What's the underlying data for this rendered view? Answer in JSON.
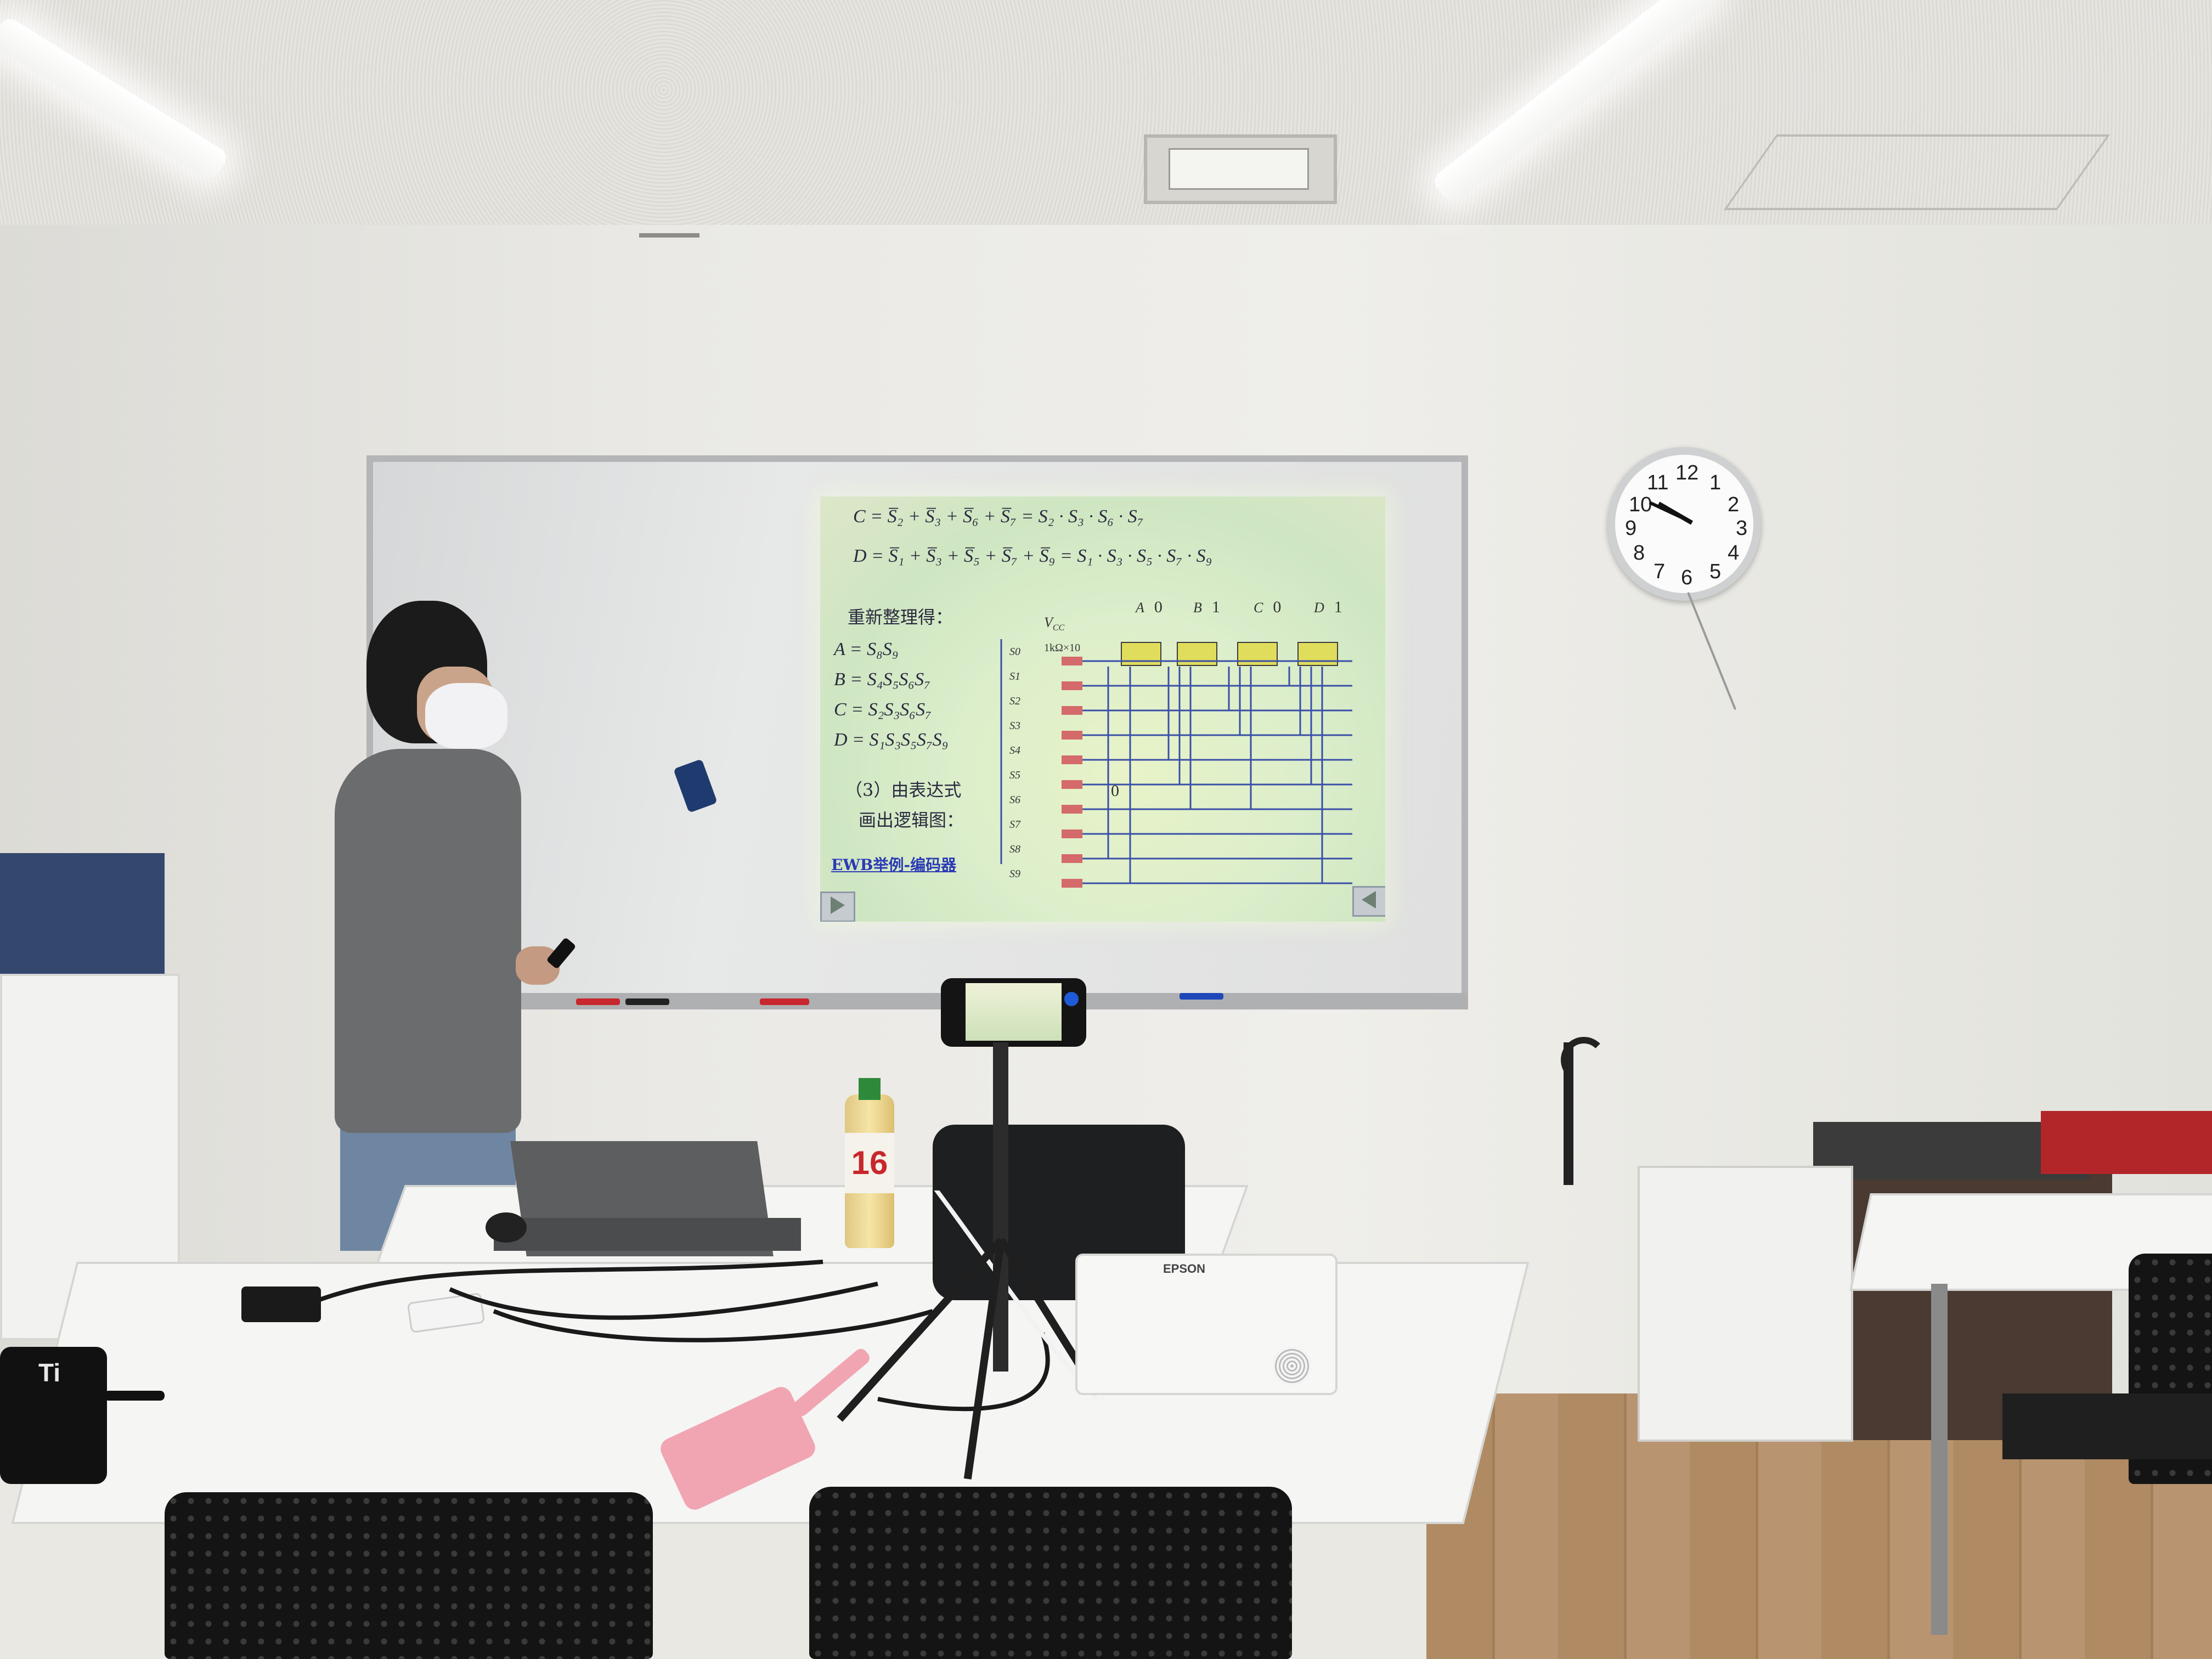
{
  "slide": {
    "eq_c": "C = S̅₂ + S̅₃ + S̅₆  + S̅₇ = S₂ · S₃ · S₆ · S₇",
    "eq_d": "D = S̅₁ + S̅₃ + S̅₅ + S̅₇ + S̅₉ = S₁ · S₃ · S₅ · S₇ · S₉",
    "heading": "重新整理得：",
    "expr_a": "A = S₈S₉",
    "expr_b": "B = S₄S₅S₆S₇",
    "expr_c": "C = S₂S₃S₆S₇",
    "expr_d": "D = S₁S₃S₅S₇S₉",
    "step_line1": "（3）由表达式",
    "step_line2": "画出逻辑图：",
    "link": "EWB举例-编码器",
    "circuit": {
      "vcc": "V",
      "vcc_sub": "CC",
      "resistor_label": "1kΩ×10",
      "outputs": [
        {
          "name": "A",
          "value": "0"
        },
        {
          "name": "B",
          "value": "1"
        },
        {
          "name": "C",
          "value": "0"
        },
        {
          "name": "D",
          "value": "1"
        }
      ],
      "switches": [
        "S0",
        "S1",
        "S2",
        "S3",
        "S4",
        "S5",
        "S6",
        "S7",
        "S8",
        "S9"
      ],
      "switch_value": "0"
    }
  },
  "clock": {
    "numbers": [
      "12",
      "1",
      "2",
      "3",
      "4",
      "5",
      "6",
      "7",
      "8",
      "9",
      "10",
      "11"
    ],
    "face_color": "#fbfbfb"
  },
  "bottle_label": "16",
  "projector_brand": "EPSON",
  "sharpener_text": "Ti",
  "colors": {
    "slide_bg": "#dceecb",
    "gate": "#e0dd5c",
    "resistor": "#d46a6a",
    "circuit_line": "#3a4fa8",
    "trash_red": "#b2262a"
  }
}
